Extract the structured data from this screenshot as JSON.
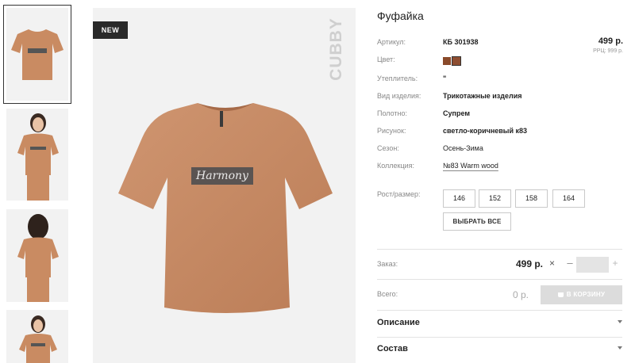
{
  "product": {
    "badge": "NEW",
    "brand": "CUBBY",
    "title": "Фуфайка",
    "shirt_print": "Harmony"
  },
  "properties": [
    {
      "label": "Артикул:",
      "value": "КБ 301938"
    },
    {
      "label": "Цвет:",
      "value": ""
    },
    {
      "label": "Утеплитель:",
      "value": "\""
    },
    {
      "label": "Вид изделия:",
      "value": "Трикотажные изделия"
    },
    {
      "label": "Полотно:",
      "value": "Супрем"
    },
    {
      "label": "Рисунок:",
      "value": "светло-коричневый к83"
    },
    {
      "label": "Сезон:",
      "value": "Осень-Зима"
    },
    {
      "label": "Коллекция:",
      "value": "№83 Warm wood"
    }
  ],
  "price": {
    "value": "499 р.",
    "rrp": "РРЦ: 999 р."
  },
  "colors": [
    "#8a4a2a",
    "#8e4e31"
  ],
  "sizes": {
    "label": "Рост/размер:",
    "options": [
      "146",
      "152",
      "158",
      "164"
    ],
    "select_all": "ВЫБРАТЬ ВСЕ"
  },
  "order": {
    "label": "Заказ:",
    "price": "499 р.",
    "times": "×",
    "minus": "–",
    "plus": "+",
    "qty": ""
  },
  "total": {
    "label": "Всего:",
    "value": "0 р.",
    "cart_button": "В КОРЗИНУ"
  },
  "accordions": [
    {
      "label": "Описание"
    },
    {
      "label": "Состав"
    }
  ]
}
